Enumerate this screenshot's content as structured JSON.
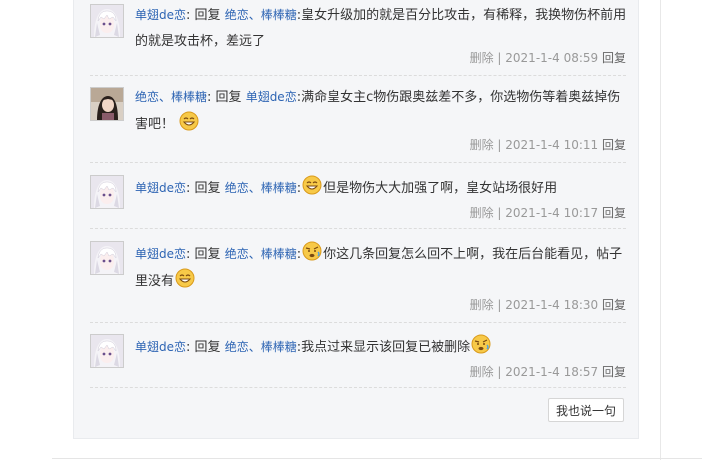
{
  "replies": [
    {
      "user": "单翅de恋",
      "reply_word": "回复",
      "target": "绝恋、棒棒糖",
      "text_before": ":皇女升级加的就是百分比攻击，有稀释，我换物伤杯前用的就是攻击杯，差远了",
      "emoji": null,
      "text_after": "",
      "delete": "删除",
      "sep": "|",
      "time": "2021-1-4 08:59",
      "reply_btn": "回复",
      "avatar_icon": "anime-girl-white-hair-avatar"
    },
    {
      "user": "绝恋、棒棒糖",
      "reply_word": "回复",
      "target": "单翅de恋",
      "text_before": ":满命皇女主c物伤跟奥兹差不多，你选物伤等着奥兹掉伤害吧！",
      "emoji": "grin-emoji",
      "text_after": "",
      "delete": "删除",
      "sep": "|",
      "time": "2021-1-4 10:11",
      "reply_btn": "回复",
      "avatar_icon": "photo-girl-avatar"
    },
    {
      "user": "单翅de恋",
      "reply_word": "回复",
      "target": "绝恋、棒棒糖",
      "text_before": ":",
      "emoji": "grin-emoji",
      "text_after": "但是物伤大大加强了啊，皇女站场很好用",
      "delete": "删除",
      "sep": "|",
      "time": "2021-1-4 10:17",
      "reply_btn": "回复",
      "avatar_icon": "anime-girl-white-hair-avatar"
    },
    {
      "user": "单翅de恋",
      "reply_word": "回复",
      "target": "绝恋、棒棒糖",
      "text_before": ":",
      "emoji": "confused-emoji",
      "text_after": "你这几条回复怎么回不上啊，我在后台能看见，帖子里没有",
      "emoji2": "grin-emoji",
      "delete": "删除",
      "sep": "|",
      "time": "2021-1-4 18:30",
      "reply_btn": "回复",
      "avatar_icon": "anime-girl-white-hair-avatar"
    },
    {
      "user": "单翅de恋",
      "reply_word": "回复",
      "target": "绝恋、棒棒糖",
      "text_before": ":我点过来显示该回复已被删除",
      "emoji": "confused-emoji",
      "text_after": "",
      "delete": "删除",
      "sep": "|",
      "time": "2021-1-4 18:57",
      "reply_btn": "回复",
      "avatar_icon": "anime-girl-white-hair-avatar"
    }
  ],
  "say_button": "我也说一句",
  "colors": {
    "link": "#2d64b3",
    "meta": "#999999",
    "panel_bg": "#f5f6f8"
  }
}
